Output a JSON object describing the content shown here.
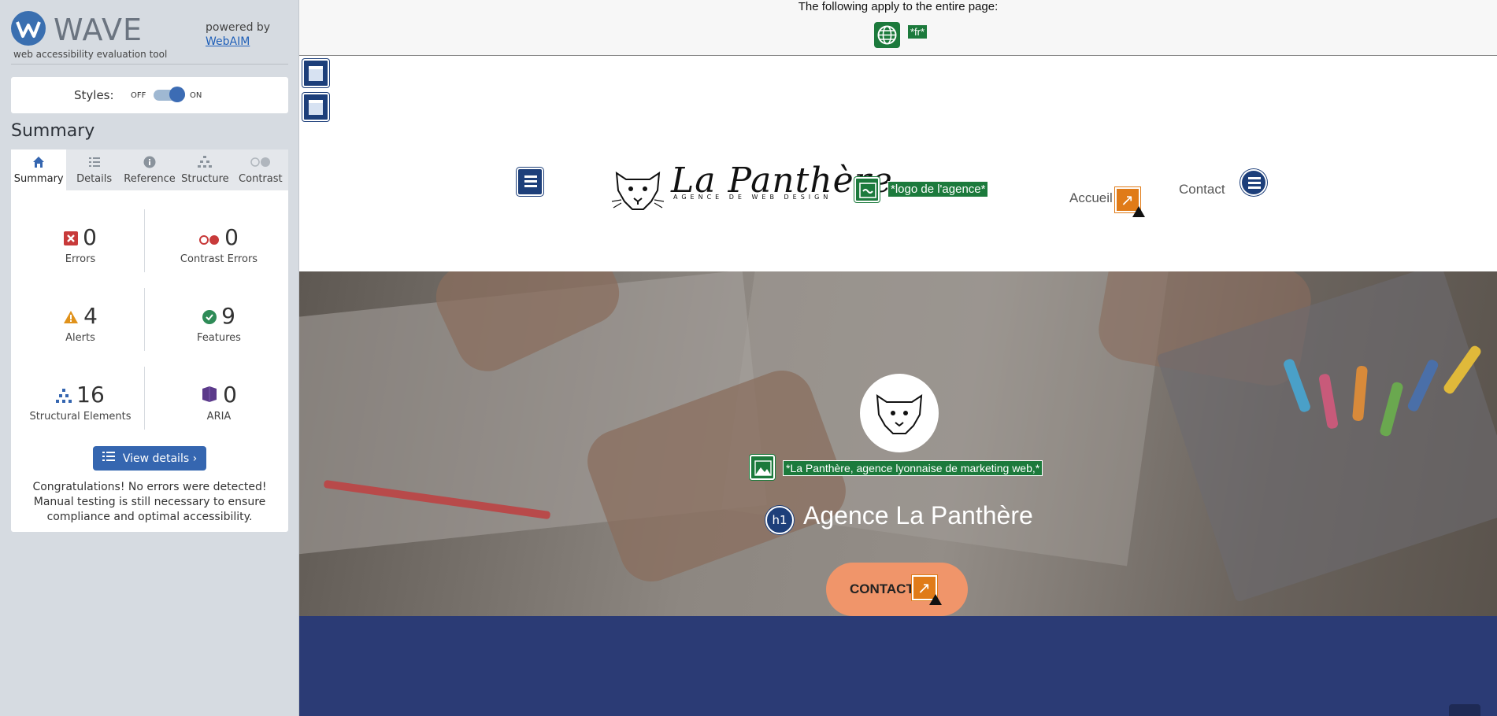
{
  "wave": {
    "title": "WAVE",
    "subtitle": "web accessibility evaluation tool",
    "powered_by": "powered by",
    "webaim_link": "WebAIM",
    "styles_label": "Styles:",
    "toggle_off": "OFF",
    "toggle_on": "ON",
    "summary_heading": "Summary",
    "tabs": [
      {
        "label": "Summary",
        "icon": "home-icon"
      },
      {
        "label": "Details",
        "icon": "list-icon"
      },
      {
        "label": "Reference",
        "icon": "info-icon"
      },
      {
        "label": "Structure",
        "icon": "structure-icon"
      },
      {
        "label": "Contrast",
        "icon": "contrast-icon"
      }
    ],
    "stats": {
      "errors": {
        "count": "0",
        "label": "Errors"
      },
      "contrast_errors": {
        "count": "0",
        "label": "Contrast Errors"
      },
      "alerts": {
        "count": "4",
        "label": "Alerts"
      },
      "features": {
        "count": "9",
        "label": "Features"
      },
      "structural": {
        "count": "16",
        "label": "Structural Elements"
      },
      "aria": {
        "count": "0",
        "label": "ARIA"
      }
    },
    "view_details": "View details ›",
    "congrats": "Congratulations! No errors were detected! Manual testing is still necessary to ensure compliance and optimal accessibility."
  },
  "page": {
    "notice": "The following apply to the entire page:",
    "lang_tag": "*fr*",
    "logo_name": "La Panthère",
    "logo_sub": "AGENCE DE WEB DESIGN",
    "logo_alt": "*logo de l'agence*",
    "nav": {
      "accueil": "Accueil",
      "contact": "Contact"
    },
    "hero_alt": "*La Panthère, agence lyonnaise de marketing web,*",
    "h1_badge": "h1",
    "hero_title": "Agence La Panthère",
    "cta": "CONTACT"
  },
  "colors": {
    "wave_blue": "#3566b0",
    "feature_green": "#1c7a3c",
    "structure_navy": "#1d3f7a",
    "alert_orange": "#e07b18",
    "cta_orange": "#f0956a",
    "band_blue": "#2b3b75"
  }
}
